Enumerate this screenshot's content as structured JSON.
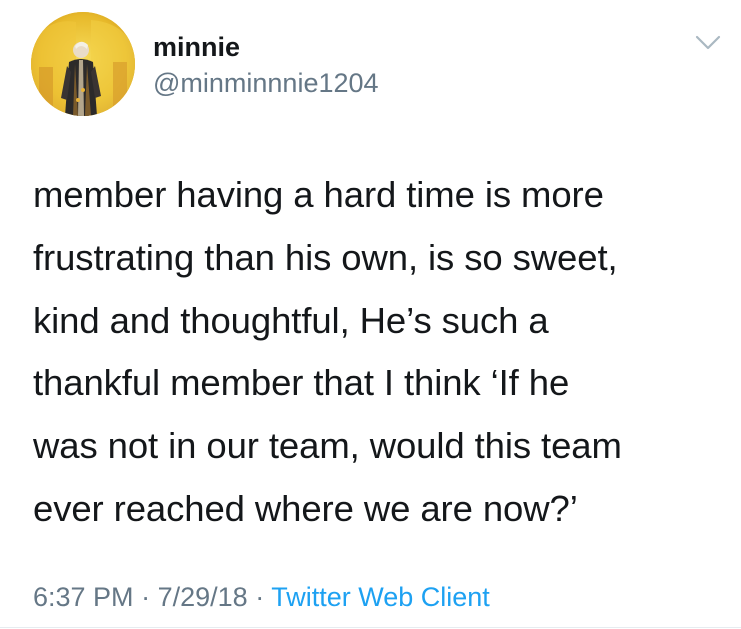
{
  "user": {
    "display_name": "minnie",
    "handle": "@minminnnie1204"
  },
  "tweet": {
    "text": "member having a hard time is more\nfrustrating than his own, is so sweet,\nkind and thoughtful, He’s such a\nthankful member that I think ‘If he\nwas not in our team, would this team\never reached where we are now?’",
    "time": "6:37 PM",
    "separator": "·",
    "date": "7/29/18",
    "client": "Twitter Web Client"
  },
  "colors": {
    "text": "#14171a",
    "secondary": "#657786",
    "link": "#1da1f2",
    "avatar_bg": "#e9c22a"
  },
  "icons": {
    "menu": "chevron-down-icon"
  }
}
